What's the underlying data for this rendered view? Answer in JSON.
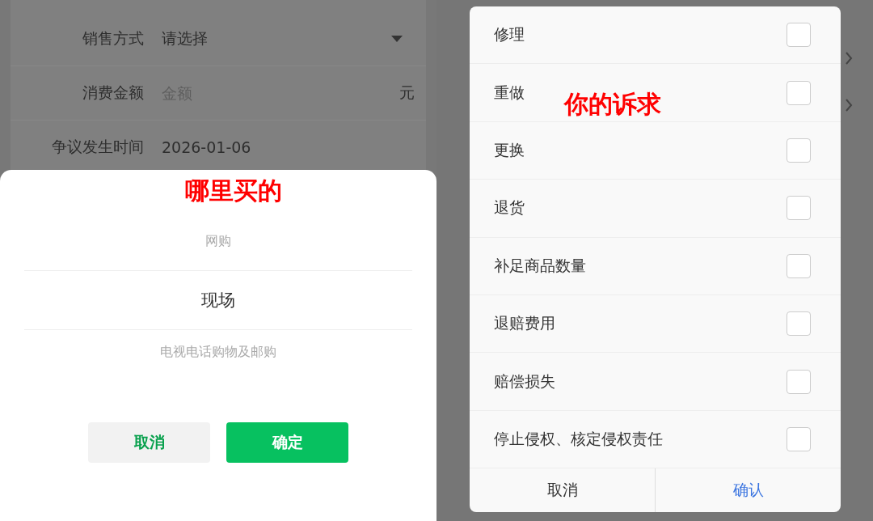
{
  "left": {
    "form": {
      "rows": [
        {
          "kind": "select",
          "label": "销售方式",
          "value": "请选择"
        },
        {
          "kind": "input",
          "label": "消费金额",
          "placeholder": "金额",
          "unit": "元"
        },
        {
          "kind": "date",
          "label": "争议发生时间",
          "value": "2026-01-06"
        }
      ]
    },
    "picker": {
      "annotation": "哪里买的",
      "options": [
        {
          "label": "网购",
          "selected": false
        },
        {
          "label": "现场",
          "selected": true
        },
        {
          "label": "电视电话购物及邮购",
          "selected": false
        }
      ],
      "buttons": [
        {
          "kind": "secondary",
          "label": "取消"
        },
        {
          "kind": "primary",
          "label": "确定"
        }
      ]
    }
  },
  "right": {
    "dialog": {
      "annotation": "你的诉求",
      "options": [
        {
          "label": "修理",
          "checked": false
        },
        {
          "label": "重做",
          "checked": false
        },
        {
          "label": "更换",
          "checked": false
        },
        {
          "label": "退货",
          "checked": false
        },
        {
          "label": "补足商品数量",
          "checked": false
        },
        {
          "label": "退赔费用",
          "checked": false
        },
        {
          "label": "赔偿损失",
          "checked": false
        },
        {
          "label": "停止侵权、核定侵权责任",
          "checked": false
        }
      ],
      "buttons": [
        {
          "kind": "plain",
          "label": "取消"
        },
        {
          "kind": "accent",
          "label": "确认"
        }
      ]
    }
  }
}
